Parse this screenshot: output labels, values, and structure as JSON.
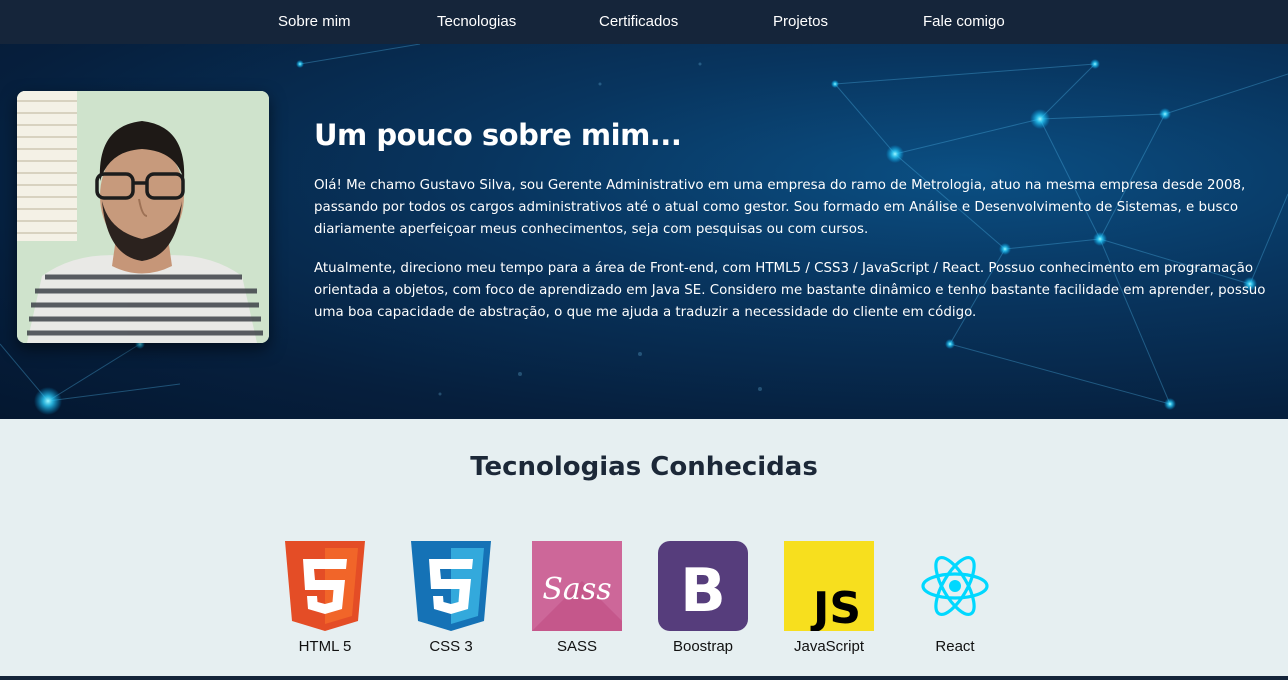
{
  "nav": {
    "items": [
      "Sobre mim",
      "Tecnologias",
      "Certificados",
      "Projetos",
      "Fale comigo"
    ]
  },
  "about": {
    "title": "Um pouco sobre mim...",
    "paragraph1": "Olá! Me chamo Gustavo Silva, sou Gerente Administrativo em uma empresa do ramo de Metrologia, atuo na mesma empresa desde 2008, passando por todos os cargos administrativos até o atual como gestor. Sou formado em Análise e Desenvolvimento de Sistemas, e busco diariamente aperfeiçoar meus conhecimentos, seja com pesquisas ou com cursos.",
    "paragraph2": "Atualmente, direciono meu tempo para a área de Front-end, com HTML5 / CSS3 / JavaScript / React. Possuo conhecimento em programação orientada a objetos, com foco de aprendizado em Java SE. Considero me bastante dinâmico e tenho bastante facilidade em aprender, possuo uma boa capacidade de abstração, o que me ajuda a traduzir a necessidade do cliente em código."
  },
  "tech": {
    "title": "Tecnologias Conhecidas",
    "items": [
      {
        "label": "HTML 5",
        "icon": "html5-icon",
        "color": "#e44d26"
      },
      {
        "label": "CSS 3",
        "icon": "css3-icon",
        "color": "#1572b6"
      },
      {
        "label": "SASS",
        "icon": "sass-icon",
        "color": "#cd6799"
      },
      {
        "label": "Boostrap",
        "icon": "bootstrap-icon",
        "color": "#563d7c"
      },
      {
        "label": "JavaScript",
        "icon": "javascript-icon",
        "color": "#f7df1e"
      },
      {
        "label": "React",
        "icon": "react-icon",
        "color": "#00d8ff"
      }
    ]
  },
  "colors": {
    "nav_bg": "#15253a",
    "hero_bg": "#08355f",
    "section_bg": "#e6eff1"
  }
}
